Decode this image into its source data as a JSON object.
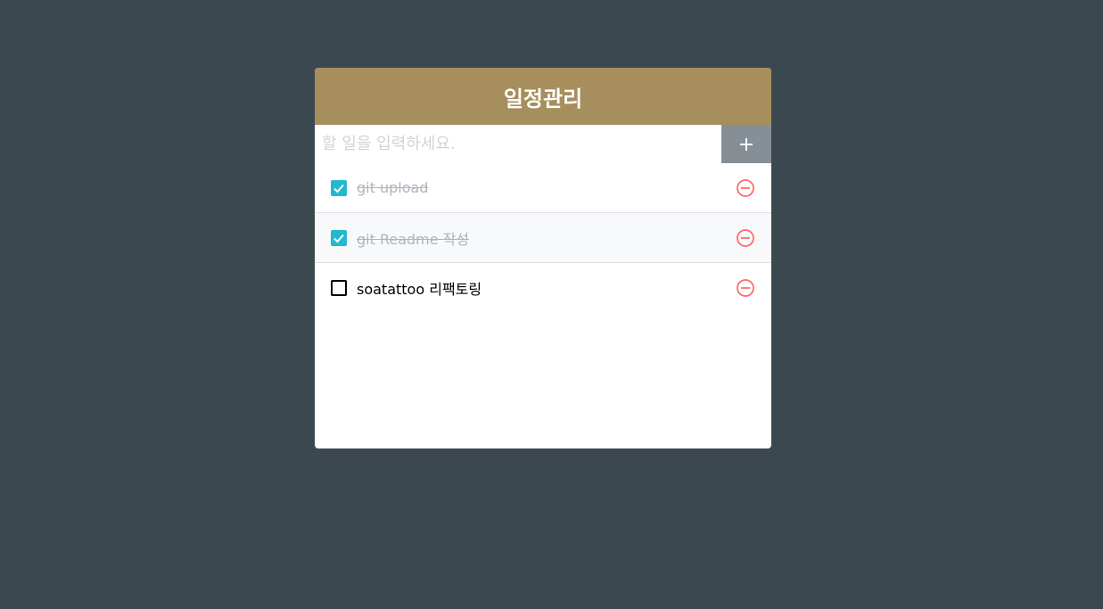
{
  "app": {
    "title": "일정관리"
  },
  "insert": {
    "placeholder": "할 일을 입력하세요.",
    "value": ""
  },
  "todos": [
    {
      "text": "git upload",
      "checked": true
    },
    {
      "text": "git Readme 작성",
      "checked": true
    },
    {
      "text": "soatattoo 리팩토링",
      "checked": false
    }
  ],
  "colors": {
    "background": "#3c4850",
    "header": "#a68e5d",
    "add_button": "#868e96",
    "checked": "#22b8cf",
    "remove": "#ff6b6b",
    "done_text": "#adb5bd"
  },
  "icons": {
    "add": "plus-icon",
    "check": "checkbox-checked-icon",
    "uncheck": "checkbox-unchecked-icon",
    "remove": "minus-circle-icon"
  }
}
